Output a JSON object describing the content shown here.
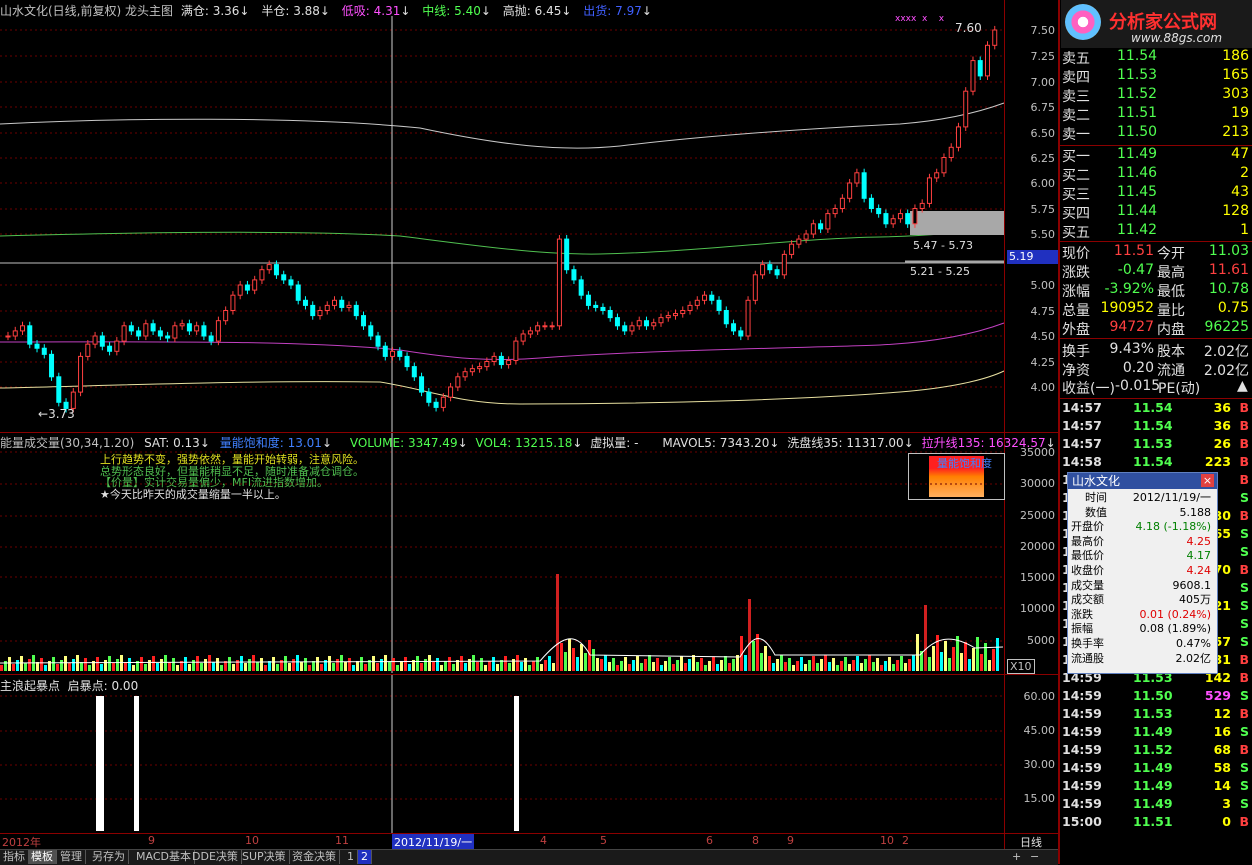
{
  "title_bar": {
    "stock_title": "山水文化(日线,前复权) 龙头主图",
    "items": [
      {
        "label": "满仓:",
        "value": "3.36",
        "color": "#e0e0e0"
      },
      {
        "label": "半仓:",
        "value": "3.88",
        "color": "#e0e0e0"
      },
      {
        "label": "低吸:",
        "value": "4.31",
        "color": "#ff50ff"
      },
      {
        "label": "中线:",
        "value": "5.40",
        "color": "#50ff50"
      },
      {
        "label": "高抛:",
        "value": "6.45",
        "color": "#e0e0e0"
      },
      {
        "label": "出货:",
        "value": "7.97",
        "color": "#4060ff"
      }
    ]
  },
  "price_axis": [
    "7.50",
    "7.25",
    "7.00",
    "6.75",
    "6.50",
    "6.25",
    "6.00",
    "5.75",
    "5.50",
    "5.19",
    "5.00",
    "4.75",
    "4.50",
    "4.25",
    "4.00"
  ],
  "annotations": {
    "high_label": "7.60",
    "low_label": "3.73",
    "range1": "5.47 - 5.73",
    "range2": "5.21 - 5.25",
    "current_price_tag": "5.19",
    "sell_marks": "xxxx  x    x"
  },
  "volume_header": {
    "name": "能量成交量(30,34,1.20)",
    "items": [
      {
        "label": "SAT:",
        "value": "0.13",
        "color": "#e0e0e0"
      },
      {
        "label": "量能饱和度:",
        "value": "13.01",
        "color": "#4080ff"
      },
      {
        "label": "VOLUME:",
        "value": "3347.49",
        "color": "#50ff50"
      },
      {
        "label": "VOL4:",
        "value": "13215.18",
        "color": "#50ff50"
      },
      {
        "label": "虚拟量:",
        "value": "-",
        "color": "#e0e0e0"
      },
      {
        "label": "MAVOL5:",
        "value": "7343.20",
        "color": "#e0e0e0"
      },
      {
        "label": "洗盘线35:",
        "value": "11317.00",
        "color": "#e0e0e0"
      },
      {
        "label": "拉升线135:",
        "value": "16324.57",
        "color": "#ff50ff"
      }
    ]
  },
  "volume_notes": [
    "上行趋势不变，强势依然，量能开始转弱，注意风险。",
    "总势形态良好，但量能稍显不足，随时准备减仓调仓。",
    "【价量】实计交易量偏少，MFI流进指数增加。",
    "★今天比昨天的成交量缩量一半以上。"
  ],
  "saturation_label": "量能饱和度",
  "volume_axis": [
    "35000",
    "30000",
    "25000",
    "20000",
    "15000",
    "10000",
    "5000"
  ],
  "volume_unit": "X10",
  "bottom_header": "主浪起暴点  启暴点: 0.00",
  "bottom_axis": [
    "60.00",
    "45.00",
    "30.00",
    "15.00"
  ],
  "date_axis": [
    "2012年",
    "9",
    "10",
    "11",
    "2012/11/19/一",
    "4",
    "5",
    "6",
    "8",
    "9",
    "10",
    "2"
  ],
  "period_label": "日线",
  "bottom_tabs": [
    "指标",
    "模板",
    "管理",
    "另存为",
    "MACD基本",
    "DDE决策",
    "SUP决策",
    "资金决策",
    "1",
    "2"
  ],
  "order_book": [
    {
      "label": "卖五",
      "price": "11.54",
      "vol": "186"
    },
    {
      "label": "卖四",
      "price": "11.53",
      "vol": "165"
    },
    {
      "label": "卖三",
      "price": "11.52",
      "vol": "303"
    },
    {
      "label": "卖二",
      "price": "11.51",
      "vol": "19"
    },
    {
      "label": "卖一",
      "price": "11.50",
      "vol": "213"
    },
    {
      "label": "买一",
      "price": "11.49",
      "vol": "47"
    },
    {
      "label": "买二",
      "price": "11.46",
      "vol": "2"
    },
    {
      "label": "买三",
      "price": "11.45",
      "vol": "43"
    },
    {
      "label": "买四",
      "price": "11.44",
      "vol": "128"
    },
    {
      "label": "买五",
      "price": "11.42",
      "vol": "1"
    }
  ],
  "quote": [
    {
      "l1": "现价",
      "v1": "11.51",
      "c1": "#ff4040",
      "l2": "今开",
      "v2": "11.03",
      "c2": "#50ff50"
    },
    {
      "l1": "涨跌",
      "v1": "-0.47",
      "c1": "#50ff50",
      "l2": "最高",
      "v2": "11.61",
      "c2": "#ff4040"
    },
    {
      "l1": "涨幅",
      "v1": "-3.92%",
      "c1": "#50ff50",
      "l2": "最低",
      "v2": "10.78",
      "c2": "#50ff50"
    },
    {
      "l1": "总量",
      "v1": "190952",
      "c1": "#ffff00",
      "l2": "量比",
      "v2": "0.75",
      "c2": "#ffff00"
    },
    {
      "l1": "外盘",
      "v1": "94727",
      "c1": "#ff4040",
      "l2": "内盘",
      "v2": "96225",
      "c2": "#50ff50"
    },
    {
      "l1": "换手",
      "v1": "9.43%",
      "c1": "#e0e0e0",
      "l2": "股本",
      "v2": "2.02亿",
      "c2": "#e0e0e0"
    },
    {
      "l1": "净资",
      "v1": "0.20",
      "c1": "#e0e0e0",
      "l2": "流通",
      "v2": "2.02亿",
      "c2": "#e0e0e0"
    }
  ],
  "pe_row": {
    "label": "收益(一)",
    "value": "-0.015",
    "pe_label": "PE(动)",
    "pe_value": ""
  },
  "ticks": [
    {
      "t": "14:57",
      "p": "11.54",
      "v": "36",
      "s": "B"
    },
    {
      "t": "14:57",
      "p": "11.54",
      "v": "36",
      "s": "B"
    },
    {
      "t": "14:57",
      "p": "11.53",
      "v": "26",
      "s": "B"
    },
    {
      "t": "14:58",
      "p": "11.54",
      "v": "223",
      "s": "B"
    },
    {
      "t": "14:58",
      "p": "",
      "v": "",
      "s": "B"
    },
    {
      "t": "14:58",
      "p": "",
      "v": "",
      "s": "S"
    },
    {
      "t": "14:58",
      "p": "",
      "v": "30",
      "s": "B"
    },
    {
      "t": "14:58",
      "p": "",
      "v": "65",
      "s": "S"
    },
    {
      "t": "14:58",
      "p": "",
      "v": "",
      "s": "S"
    },
    {
      "t": "14:58",
      "p": "",
      "v": "70",
      "s": "B"
    },
    {
      "t": "14:58",
      "p": "",
      "v": "",
      "s": "S"
    },
    {
      "t": "14:58",
      "p": "",
      "v": "21",
      "s": "S"
    },
    {
      "t": "14:59",
      "p": "",
      "v": "",
      "s": "S"
    },
    {
      "t": "14:59",
      "p": "",
      "v": "57",
      "s": "S"
    },
    {
      "t": "14:59",
      "p": "11.53",
      "v": "31",
      "s": "B"
    },
    {
      "t": "14:59",
      "p": "11.53",
      "v": "142",
      "s": "B"
    },
    {
      "t": "14:59",
      "p": "11.50",
      "v": "529",
      "s": "S"
    },
    {
      "t": "14:59",
      "p": "11.53",
      "v": "12",
      "s": "B"
    },
    {
      "t": "14:59",
      "p": "11.49",
      "v": "16",
      "s": "S"
    },
    {
      "t": "14:59",
      "p": "11.52",
      "v": "68",
      "s": "B"
    },
    {
      "t": "14:59",
      "p": "11.49",
      "v": "58",
      "s": "S"
    },
    {
      "t": "14:59",
      "p": "11.49",
      "v": "14",
      "s": "S"
    },
    {
      "t": "14:59",
      "p": "11.49",
      "v": "3",
      "s": "S"
    },
    {
      "t": "15:00",
      "p": "11.51",
      "v": "0",
      "s": "B"
    }
  ],
  "popup": {
    "title": "山水文化",
    "close": "×",
    "rows": [
      {
        "k": "时间",
        "v": "2012/11/19/一",
        "c": "#000000"
      },
      {
        "k": "数值",
        "v": "5.188",
        "c": "#000000"
      },
      {
        "k": "开盘价",
        "v": "4.18 (-1.18%)",
        "c": "#008000"
      },
      {
        "k": "最高价",
        "v": "4.25",
        "c": "#e00000"
      },
      {
        "k": "最低价",
        "v": "4.17",
        "c": "#008000"
      },
      {
        "k": "收盘价",
        "v": "4.24",
        "c": "#e00000"
      },
      {
        "k": "成交量",
        "v": "9608.1",
        "c": "#000000"
      },
      {
        "k": "成交额",
        "v": "405万",
        "c": "#000000"
      },
      {
        "k": "涨跌",
        "v": "0.01 (0.24%)",
        "c": "#e00000"
      },
      {
        "k": "振幅",
        "v": "0.08 (1.89%)",
        "c": "#000000"
      },
      {
        "k": "换手率",
        "v": "0.47%",
        "c": "#000000"
      },
      {
        "k": "流通股",
        "v": "2.02亿",
        "c": "#000000"
      }
    ]
  },
  "logo": {
    "name": "分析家公式网",
    "url": "www.88gs.com"
  },
  "colors": {
    "up": "#ff4040",
    "down": "#00ffff",
    "grid": "#8b0000"
  },
  "chart_data": {
    "type": "candlestick",
    "ylim": [
      3.7,
      7.6
    ],
    "closes": [
      4.5,
      4.55,
      4.6,
      4.42,
      4.38,
      4.32,
      4.1,
      3.85,
      3.79,
      3.95,
      4.3,
      4.42,
      4.5,
      4.4,
      4.35,
      4.45,
      4.6,
      4.55,
      4.5,
      4.62,
      4.55,
      4.5,
      4.48,
      4.6,
      4.62,
      4.55,
      4.6,
      4.5,
      4.45,
      4.65,
      4.75,
      4.9,
      5.0,
      4.95,
      5.05,
      5.15,
      5.2,
      5.1,
      5.05,
      5.0,
      4.85,
      4.8,
      4.7,
      4.75,
      4.8,
      4.85,
      4.78,
      4.8,
      4.7,
      4.6,
      4.5,
      4.4,
      4.3,
      4.35,
      4.3,
      4.2,
      4.1,
      3.95,
      3.85,
      3.8,
      3.9,
      4.0,
      4.1,
      4.15,
      4.18,
      4.2,
      4.25,
      4.3,
      4.22,
      4.26,
      4.45,
      4.52,
      4.55,
      4.6,
      4.6,
      4.6,
      5.45,
      5.15,
      5.05,
      4.9,
      4.8,
      4.78,
      4.75,
      4.68,
      4.6,
      4.55,
      4.6,
      4.65,
      4.6,
      4.63,
      4.68,
      4.7,
      4.72,
      4.75,
      4.8,
      4.85,
      4.9,
      4.85,
      4.75,
      4.62,
      4.55,
      4.5,
      4.85,
      5.1,
      5.2,
      5.15,
      5.1,
      5.3,
      5.4,
      5.45,
      5.5,
      5.6,
      5.55,
      5.7,
      5.75,
      5.85,
      6.0,
      6.1,
      5.85,
      5.75,
      5.7,
      5.6,
      5.65,
      5.7,
      5.6,
      5.75,
      5.8,
      6.05,
      6.1,
      6.25,
      6.35,
      6.55,
      6.9,
      7.2,
      7.05,
      7.35,
      7.5
    ]
  }
}
